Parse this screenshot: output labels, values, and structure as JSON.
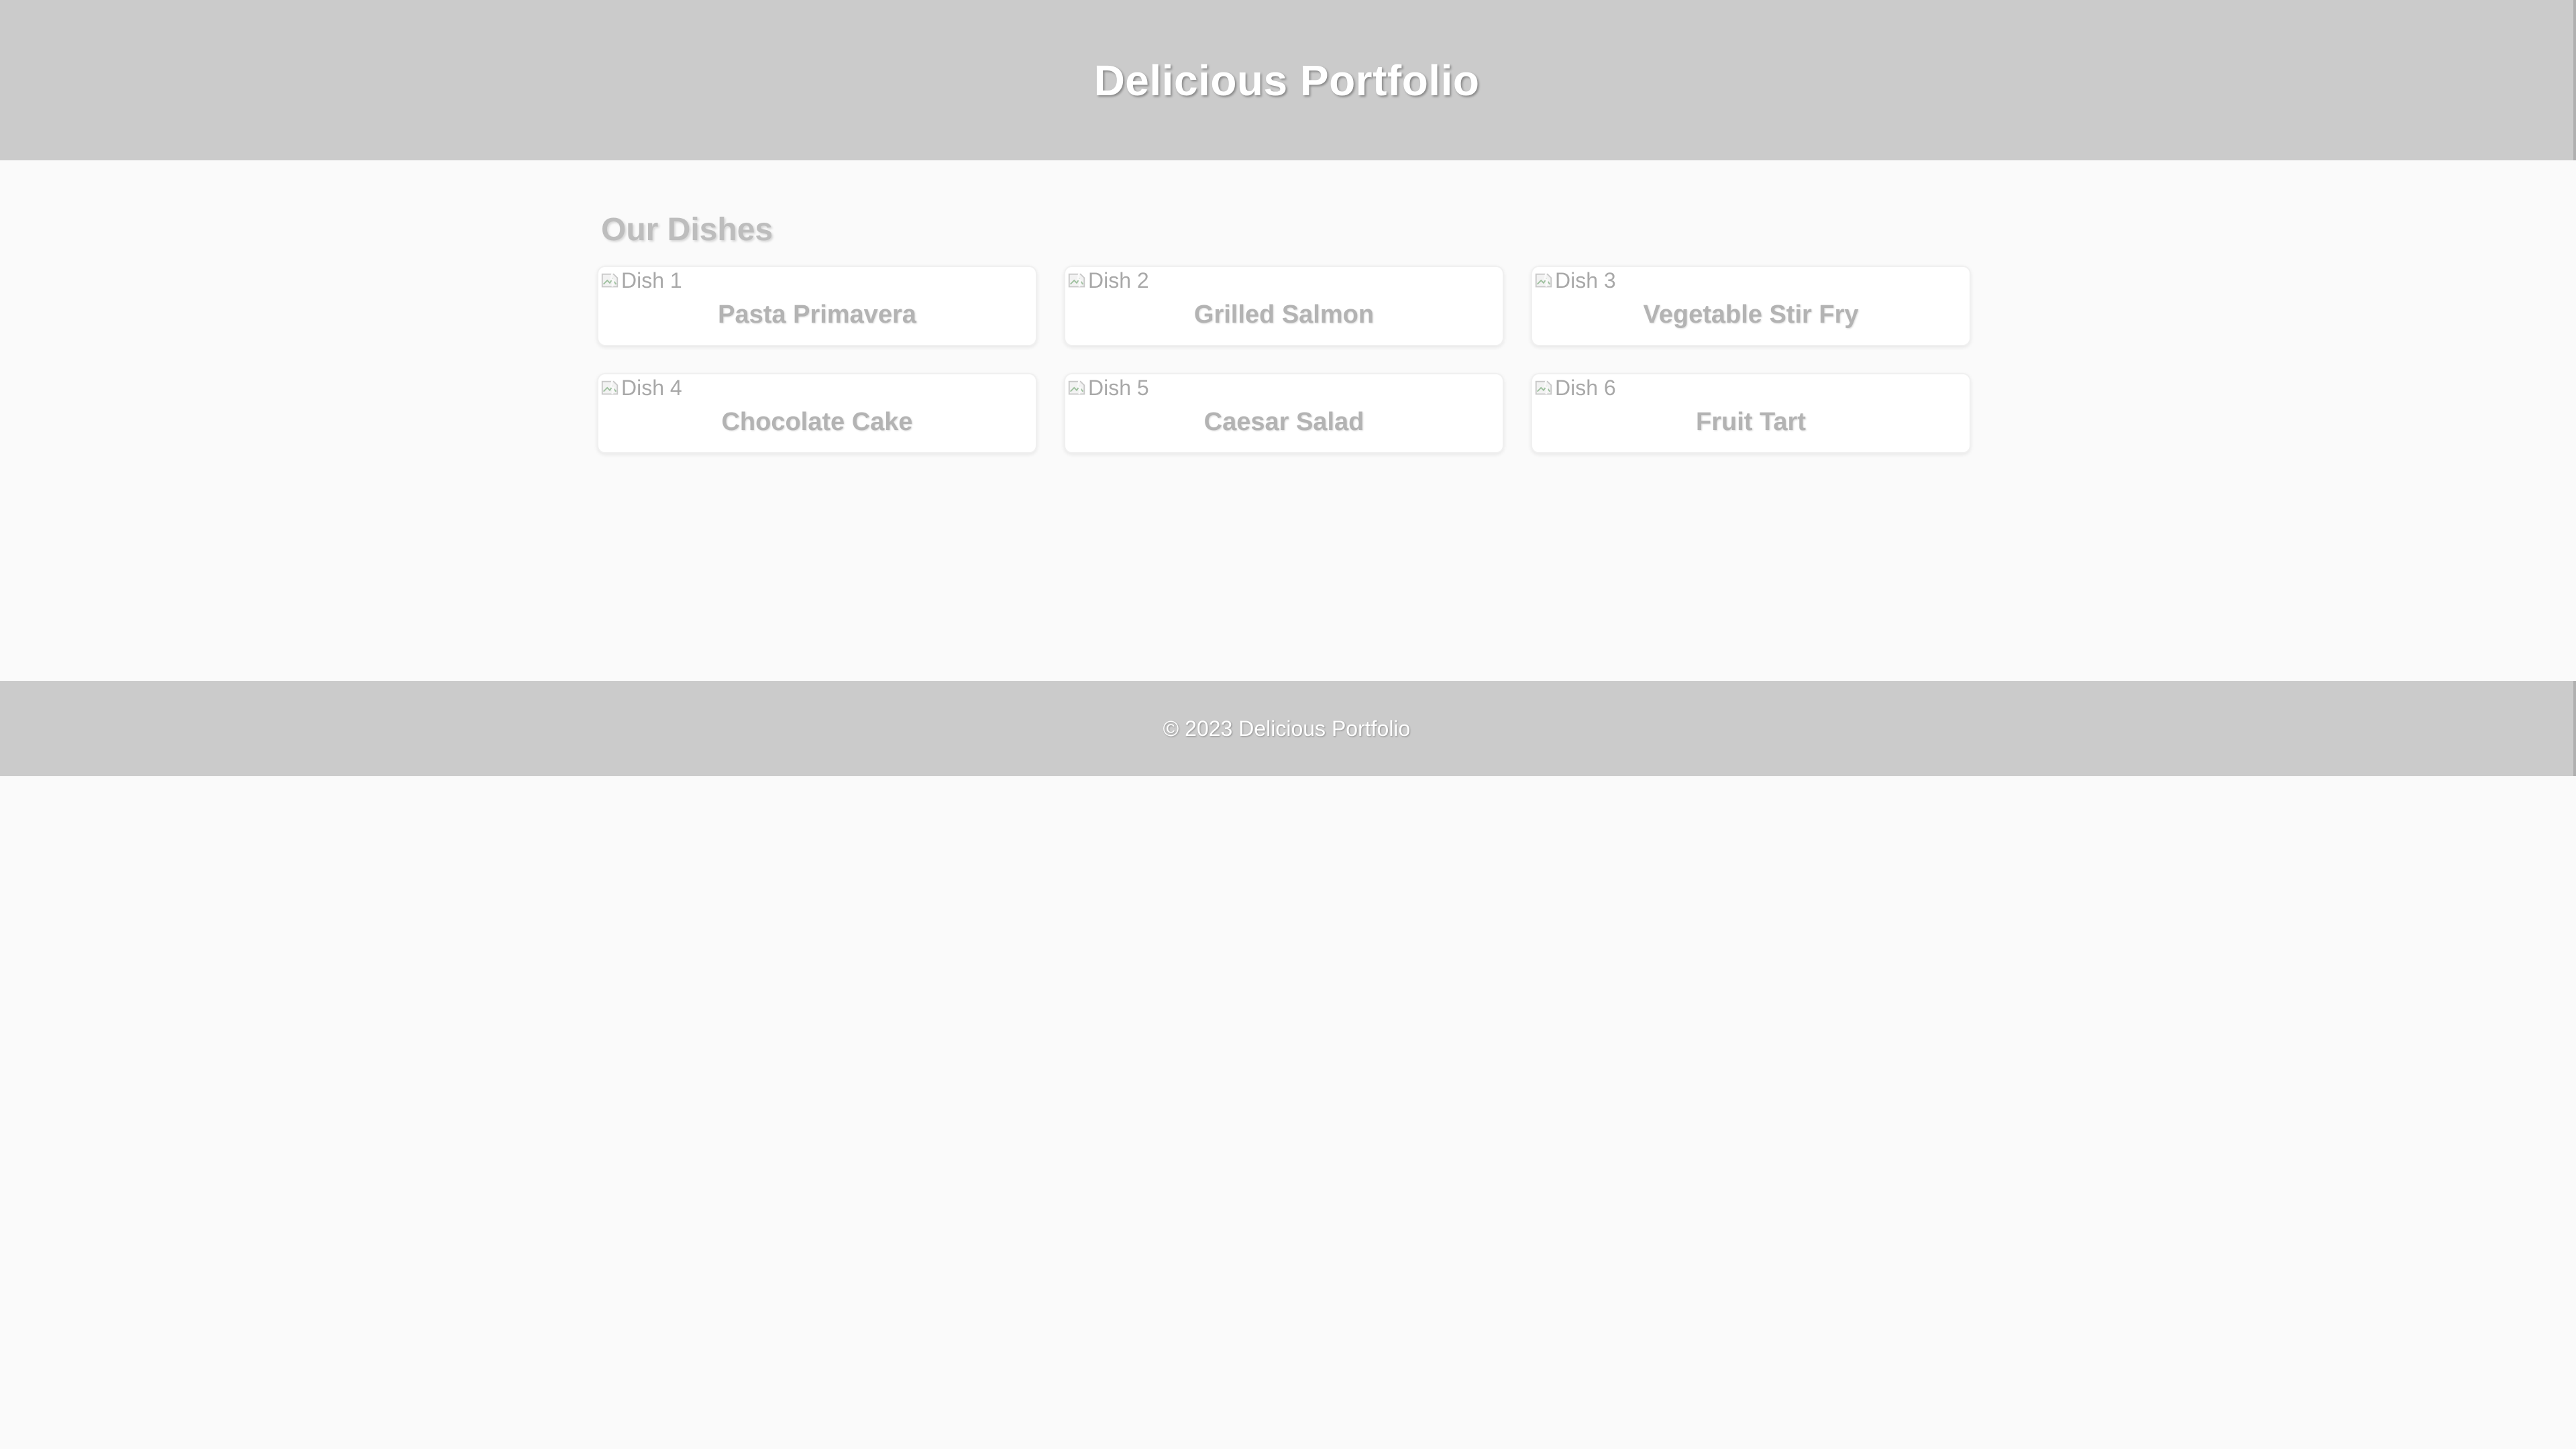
{
  "header": {
    "title": "Delicious Portfolio"
  },
  "main": {
    "section_title": "Our Dishes",
    "dishes": [
      {
        "image_alt": "Dish 1",
        "name": "Pasta Primavera"
      },
      {
        "image_alt": "Dish 2",
        "name": "Grilled Salmon"
      },
      {
        "image_alt": "Dish 3",
        "name": "Vegetable Stir Fry"
      },
      {
        "image_alt": "Dish 4",
        "name": "Chocolate Cake"
      },
      {
        "image_alt": "Dish 5",
        "name": "Caesar Salad"
      },
      {
        "image_alt": "Dish 6",
        "name": "Fruit Tart"
      }
    ]
  },
  "footer": {
    "copyright": "© 2023 Delicious Portfolio"
  },
  "icons": {
    "image": "broken-image-icon"
  },
  "colors": {
    "header_bg": "#cbcbcb",
    "page_bg": "#fafafa",
    "card_bg": "#ffffff",
    "title_text": "#ffffff",
    "muted_text": "#b3b3b3"
  }
}
